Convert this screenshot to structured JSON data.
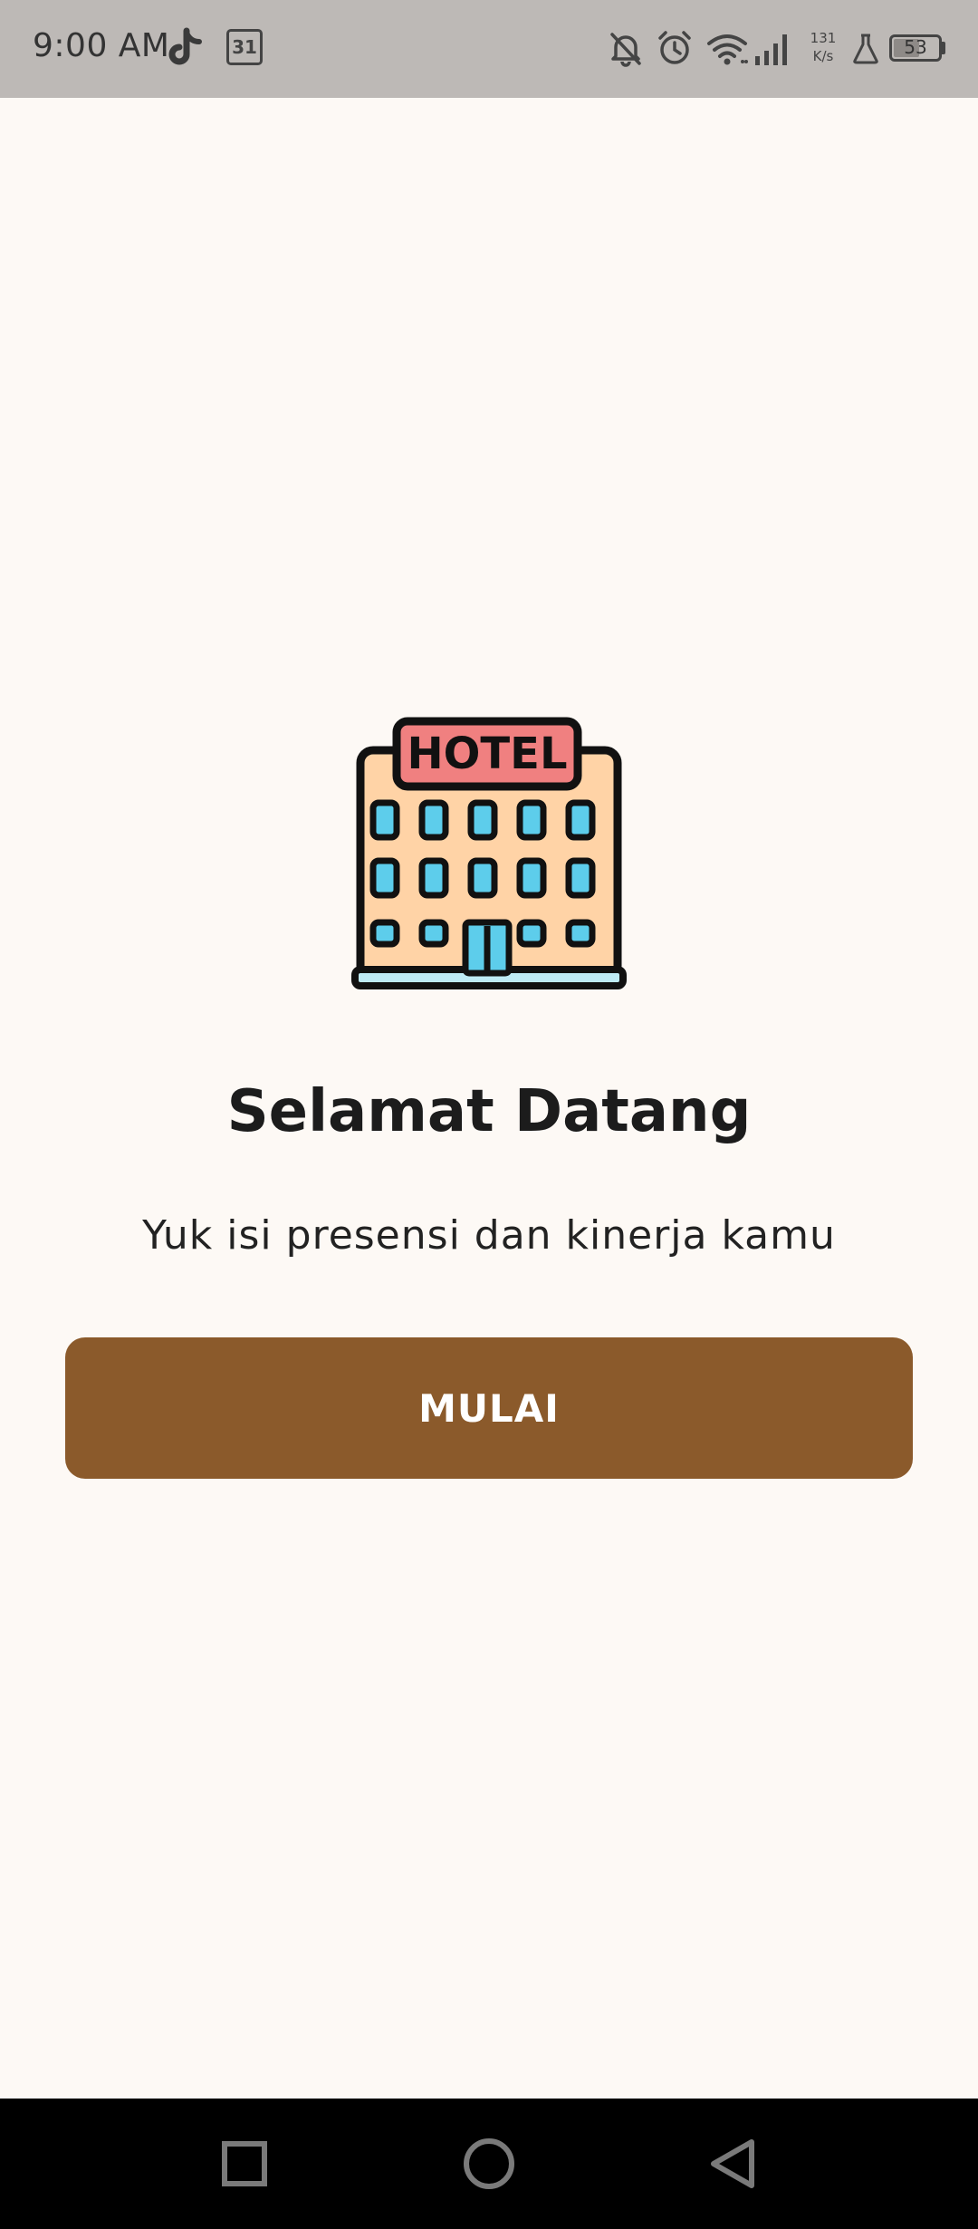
{
  "status_bar": {
    "time": "9:00 AM",
    "calendar_day": "31",
    "speed_value": "131",
    "speed_unit": "K/s",
    "battery_level": "53",
    "icons": [
      "tiktok-icon",
      "calendar-icon",
      "notifications-off-icon",
      "alarm-icon",
      "wifi-icon",
      "signal-icon",
      "flask-icon",
      "battery-icon"
    ]
  },
  "main": {
    "illustration_label": "HOTEL",
    "title": "Selamat Datang",
    "subtitle": "Yuk isi presensi dan kinerja kamu",
    "start_button_label": "MULAI"
  },
  "nav_bar": {
    "icons": [
      "recent-apps-icon",
      "home-icon",
      "back-icon"
    ]
  },
  "colors": {
    "background": "#FDF9F5",
    "status_bar": "#BDB9B6",
    "button": "#8B5A2B",
    "button_text": "#FFFFFF",
    "hotel_sign": "#F08080",
    "hotel_body": "#FFD3A6",
    "windows": "#5DCDEB"
  }
}
